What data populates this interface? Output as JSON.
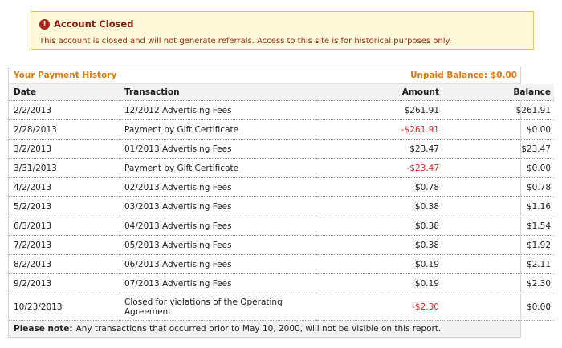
{
  "alert": {
    "title": "Account Closed",
    "message": "This account is closed and will not generate referrals. Access to this site is for historical purposes only.",
    "icon": "error-exclamation-icon"
  },
  "history": {
    "title": "Your Payment History",
    "unpaid_balance": "Unpaid Balance: $0.00",
    "columns": [
      "Date",
      "Transaction",
      "Amount",
      "Balance"
    ],
    "rows": [
      {
        "date": "2/2/2013",
        "transaction": "12/2012 Advertising Fees",
        "amount": "$261.91",
        "balance": "$261.91",
        "negative": false
      },
      {
        "date": "2/28/2013",
        "transaction": "Payment by Gift Certificate",
        "amount": "-$261.91",
        "balance": "$0.00",
        "negative": true
      },
      {
        "date": "3/2/2013",
        "transaction": "01/2013 Advertising Fees",
        "amount": "$23.47",
        "balance": "$23.47",
        "negative": false
      },
      {
        "date": "3/31/2013",
        "transaction": "Payment by Gift Certificate",
        "amount": "-$23.47",
        "balance": "$0.00",
        "negative": true
      },
      {
        "date": "4/2/2013",
        "transaction": "02/2013 Advertising Fees",
        "amount": "$0.78",
        "balance": "$0.78",
        "negative": false
      },
      {
        "date": "5/2/2013",
        "transaction": "03/2013 Advertising Fees",
        "amount": "$0.38",
        "balance": "$1.16",
        "negative": false
      },
      {
        "date": "6/3/2013",
        "transaction": "04/2013 Advertising Fees",
        "amount": "$0.38",
        "balance": "$1.54",
        "negative": false
      },
      {
        "date": "7/2/2013",
        "transaction": "05/2013 Advertising Fees",
        "amount": "$0.38",
        "balance": "$1.92",
        "negative": false
      },
      {
        "date": "8/2/2013",
        "transaction": "06/2013 Advertising Fees",
        "amount": "$0.19",
        "balance": "$2.11",
        "negative": false
      },
      {
        "date": "9/2/2013",
        "transaction": "07/2013 Advertising Fees",
        "amount": "$0.19",
        "balance": "$2.30",
        "negative": false
      },
      {
        "date": "10/23/2013",
        "transaction": "Closed for violations of the Operating Agreement",
        "amount": "-$2.30",
        "balance": "$0.00",
        "negative": true
      }
    ],
    "note_label": "Please note:",
    "note_text": "Any transactions that occurred prior to May 10, 2000, will not be visible on this report."
  },
  "colors": {
    "accent": "#e07a10",
    "alert_text": "#9b2a1e",
    "alert_bg": "#fdf8d7",
    "negative": "#e0282a"
  }
}
